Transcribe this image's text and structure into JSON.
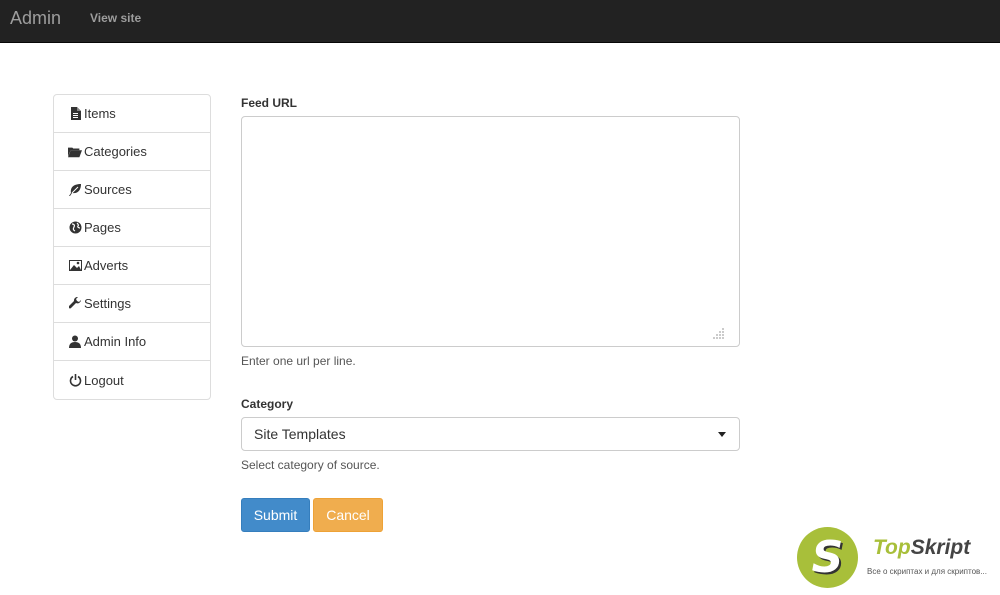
{
  "navbar": {
    "brand": "Admin",
    "view_site": "View site"
  },
  "sidebar": {
    "items": [
      {
        "label": "Items",
        "icon": "file-icon"
      },
      {
        "label": "Categories",
        "icon": "folder-open-icon"
      },
      {
        "label": "Sources",
        "icon": "leaf-icon"
      },
      {
        "label": "Pages",
        "icon": "globe-icon"
      },
      {
        "label": "Adverts",
        "icon": "picture-icon"
      },
      {
        "label": "Settings",
        "icon": "wrench-icon"
      },
      {
        "label": "Admin Info",
        "icon": "user-icon"
      },
      {
        "label": "Logout",
        "icon": "power-icon"
      }
    ]
  },
  "form": {
    "feed_url_label": "Feed URL",
    "feed_url_value": "",
    "feed_url_help": "Enter one url per line.",
    "category_label": "Category",
    "category_selected": "Site Templates",
    "category_help": "Select category of source.",
    "submit_label": "Submit",
    "cancel_label": "Cancel"
  },
  "watermark": {
    "logo_letter": "S",
    "title_part1": "Top",
    "title_part2": "Skript",
    "subtitle": "Все о скриптах и для скриптов..."
  },
  "colors": {
    "navbar_bg": "#222222",
    "primary": "#428bca",
    "warning": "#f0ad4e",
    "watermark_green": "#a8bf3a"
  }
}
